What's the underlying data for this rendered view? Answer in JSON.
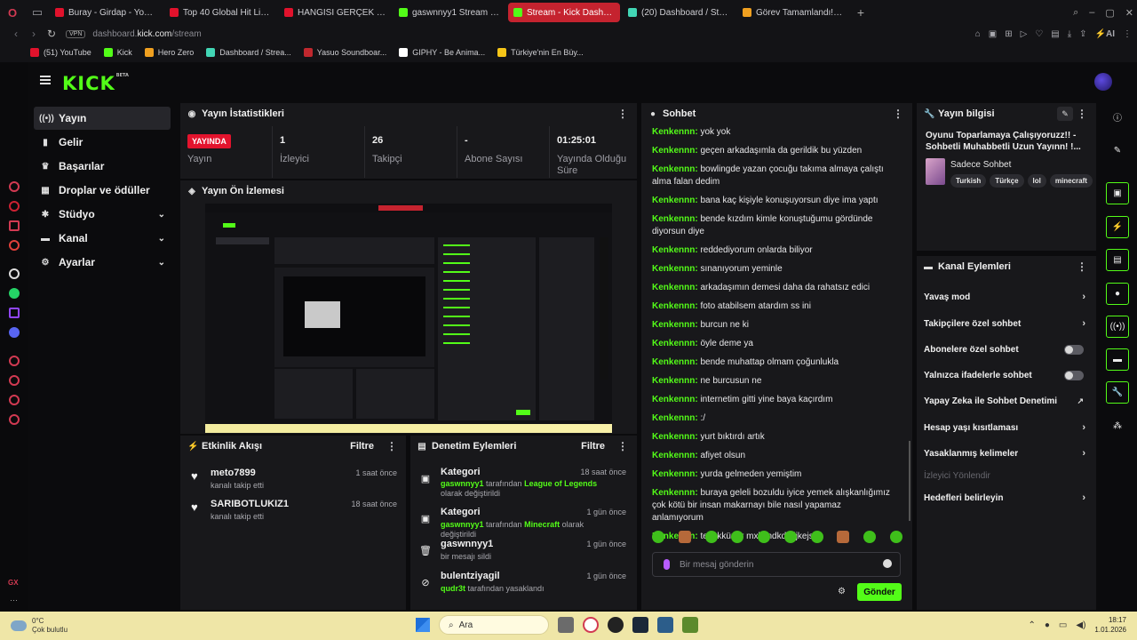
{
  "browser": {
    "tabs": [
      {
        "label": "Buray - Girdap - YouTube",
        "color": "#e1122c"
      },
      {
        "label": "Top 40 Global Hit List 🎉",
        "color": "#e1122c"
      },
      {
        "label": "HANGİSİ GERÇEK GURBE",
        "color": "#e1122c"
      },
      {
        "label": "gaswnnyy1 Stream - Watc",
        "color": "#53fc18"
      },
      {
        "label": "Stream - Kick Dashboard",
        "color": "#53fc18"
      },
      {
        "label": "(20) Dashboard / Streamla",
        "color": "#42d6b5"
      },
      {
        "label": "Görev Tamamlandı! – Hero",
        "color": "#f0a020"
      }
    ],
    "url_prefix": "dashboard.",
    "url_domain": "kick.com",
    "url_path": "/stream",
    "vpn_label": "VPN",
    "bookmarks": [
      {
        "label": "(51) YouTube",
        "color": "#e1122c"
      },
      {
        "label": "Kick",
        "color": "#53fc18"
      },
      {
        "label": "Hero Zero",
        "color": "#f0a020"
      },
      {
        "label": "Dashboard / Strea...",
        "color": "#42d6b5"
      },
      {
        "label": "Yasuo Soundboar...",
        "color": "#c0282e"
      },
      {
        "label": "GIPHY - Be Anima...",
        "color": "#ffffff"
      },
      {
        "label": "Türkiye'nin En Büy...",
        "color": "#f5c518"
      }
    ]
  },
  "kick": {
    "logo": "KICK",
    "logo_badge": "BETA",
    "sidebar": [
      {
        "label": "Yayın",
        "active": true
      },
      {
        "label": "Gelir"
      },
      {
        "label": "Başarılar"
      },
      {
        "label": "Droplar ve ödüller"
      },
      {
        "label": "Stüdyo"
      },
      {
        "label": "Kanal"
      },
      {
        "label": "Ayarlar"
      }
    ],
    "stats": {
      "title": "Yayın İstatistikleri",
      "live_badge": "YAYINDA",
      "items": [
        {
          "value": "",
          "label": "Yayın"
        },
        {
          "value": "1",
          "label": "İzleyici"
        },
        {
          "value": "26",
          "label": "Takipçi"
        },
        {
          "value": "-",
          "label": "Abone Sayısı"
        },
        {
          "value": "01:25:01",
          "label": "Yayında Olduğu Süre"
        }
      ]
    },
    "preview": {
      "title": "Yayın Ön İzlemesi"
    },
    "activity": {
      "title": "Etkinlik Akışı",
      "filter": "Filtre",
      "items": [
        {
          "name": "meto7899",
          "sub": "kanalı takip etti",
          "time": "1 saat önce"
        },
        {
          "name": "SARIBOTLUKIZ1",
          "sub": "kanalı takip etti",
          "time": "18 saat önce"
        }
      ]
    },
    "moderation": {
      "title": "Denetim Eylemleri",
      "filter": "Filtre",
      "items": [
        {
          "name": "Kategori",
          "user": "gaswnnyy1",
          "mid": " tarafından ",
          "target": "League of Legends",
          "end": " olarak değiştirildi",
          "time": "18 saat önce"
        },
        {
          "name": "Kategori",
          "user": "gaswnnyy1",
          "mid": " tarafından ",
          "target": "Minecraft",
          "end": " olarak değiştirildi",
          "time": "1 gün önce"
        },
        {
          "name": "gaswnnyy1",
          "user": "",
          "mid": "bir mesajı sildi",
          "target": "",
          "end": "",
          "time": "1 gün önce"
        },
        {
          "name": "bulentziyagil",
          "user": "qudr3t",
          "mid": " tarafından yasaklandı",
          "target": "",
          "end": "",
          "time": "1 gün önce"
        }
      ]
    },
    "chat": {
      "title": "Sohbet",
      "messages": [
        {
          "user": "Kenkennn:",
          "text": " yok yok"
        },
        {
          "user": "Kenkennn:",
          "text": " geçen arkadaşımla da gerildik bu yüzden"
        },
        {
          "user": "Kenkennn:",
          "text": " bowlingde yazan çocuğu takıma almaya çalıştı alma falan dedim"
        },
        {
          "user": "Kenkennn:",
          "text": " bana kaç kişiyle konuşuyorsun diye ima yaptı"
        },
        {
          "user": "Kenkennn:",
          "text": " bende kızdım kimle konuştuğumu gördünde diyorsun diye"
        },
        {
          "user": "Kenkennn:",
          "text": " reddediyorum onlarda biliyor"
        },
        {
          "user": "Kenkennn:",
          "text": " sınanıyorum yeminle"
        },
        {
          "user": "Kenkennn:",
          "text": " arkadaşımın demesi daha da rahatsız edici"
        },
        {
          "user": "Kenkennn:",
          "text": " foto atabilsem atardım ss ini"
        },
        {
          "user": "Kenkennn:",
          "text": " burcun ne ki"
        },
        {
          "user": "Kenkennn:",
          "text": " öyle deme ya"
        },
        {
          "user": "Kenkennn:",
          "text": " bende muhattap olmam çoğunlukla"
        },
        {
          "user": "Kenkennn:",
          "text": " ne burcusun ne"
        },
        {
          "user": "Kenkennn:",
          "text": " internetim gitti yine baya kaçırdım"
        },
        {
          "user": "Kenkennn:",
          "text": " :/"
        },
        {
          "user": "Kenkennn:",
          "text": " yurt bıktırdı artık"
        },
        {
          "user": "Kenkennn:",
          "text": " afiyet olsun"
        },
        {
          "user": "Kenkennn:",
          "text": " yurda gelmeden yemiştim"
        },
        {
          "user": "Kenkennn:",
          "text": " buraya geleli bozuldu iyice yemek alışkanlığımız çok kötü bir insan makarnayı bile nasıl yapamaz anlamıyorum"
        },
        {
          "user": "Kenkennn:",
          "text": " teşekkürler mxkxndkdkdjkejs"
        }
      ],
      "input_placeholder": "Bir mesaj gönderin",
      "send_label": "Gönder"
    },
    "stream_info": {
      "title": "Yayın bilgisi",
      "stream_title": "Oyunu Toparlamaya Çalışıyoruzz!! - Sohbetli Muhabbetli Uzun Yayınn! !...",
      "category": "Sadece Sohbet",
      "tags": [
        "Turkish",
        "Türkçe",
        "lol",
        "minecraft"
      ]
    },
    "channel_actions": {
      "title": "Kanal Eylemleri",
      "items": [
        {
          "label": "Yavaş mod",
          "control": "chevron"
        },
        {
          "label": "Takipçilere özel sohbet",
          "control": "chevron"
        },
        {
          "label": "Abonelere özel sohbet",
          "control": "toggle"
        },
        {
          "label": "Yalnızca ifadelerle sohbet",
          "control": "toggle"
        },
        {
          "label": "Yapay Zeka ile Sohbet Denetimi",
          "control": "external"
        },
        {
          "label": "Hesap yaşı kısıtlaması",
          "control": "chevron"
        },
        {
          "label": "Yasaklanmış kelimeler",
          "control": "chevron"
        },
        {
          "label": "İzleyici Yönlendir",
          "control": "none",
          "disabled": true
        },
        {
          "label": "Hedefleri belirleyin",
          "control": "chevron"
        }
      ]
    }
  },
  "taskbar": {
    "temp": "0°C",
    "weather": "Çok bulutlu",
    "search": "Ara",
    "time": "18:17",
    "date": "1.01.2026"
  }
}
